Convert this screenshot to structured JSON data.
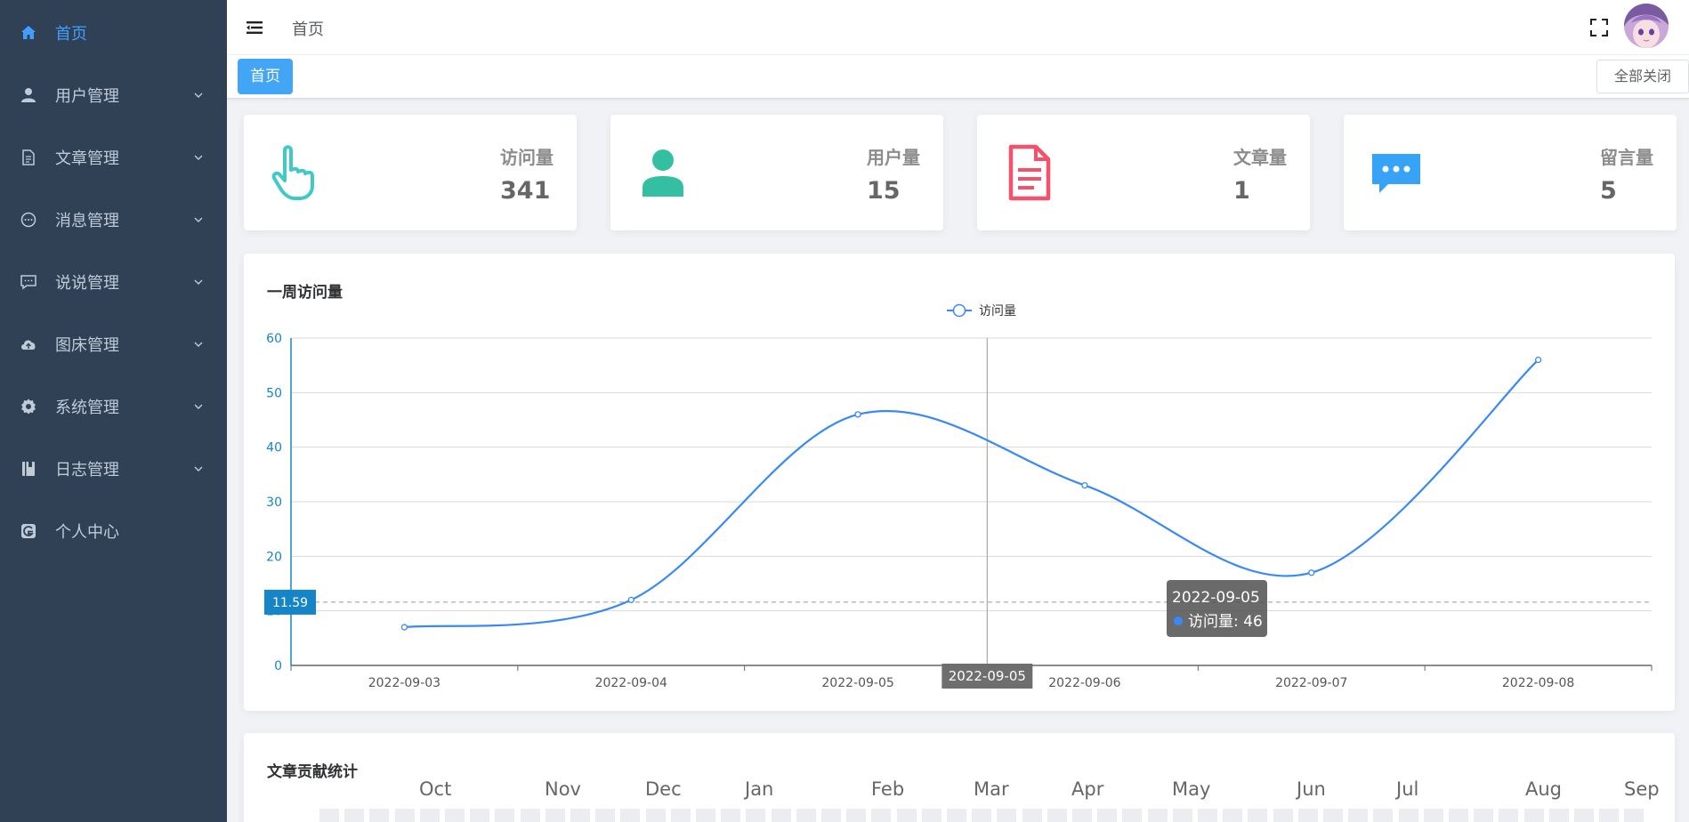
{
  "sidebar": {
    "items": [
      {
        "label": "首页",
        "icon": "home-icon",
        "active": true
      },
      {
        "label": "用户管理",
        "icon": "user-icon"
      },
      {
        "label": "文章管理",
        "icon": "document-icon"
      },
      {
        "label": "消息管理",
        "icon": "chat-icon"
      },
      {
        "label": "说说管理",
        "icon": "comment-icon"
      },
      {
        "label": "图床管理",
        "icon": "cloud-upload-icon"
      },
      {
        "label": "系统管理",
        "icon": "gear-icon"
      },
      {
        "label": "日志管理",
        "icon": "book-icon"
      },
      {
        "label": "个人中心",
        "icon": "profile-icon"
      }
    ]
  },
  "header": {
    "breadcrumb": "首页"
  },
  "tags": {
    "active": "首页",
    "close_all": "全部关闭"
  },
  "stats": [
    {
      "label": "访问量",
      "value": "341",
      "icon": "pointer-hand-icon",
      "color": "#40c9c6"
    },
    {
      "label": "用户量",
      "value": "15",
      "icon": "user-icon",
      "color": "#34bfa3"
    },
    {
      "label": "文章量",
      "value": "1",
      "icon": "document-icon",
      "color": "#f4516c"
    },
    {
      "label": "留言量",
      "value": "5",
      "icon": "message-icon",
      "color": "#36a3f7"
    }
  ],
  "chart_panel": {
    "title": "一周访问量"
  },
  "chart_data": {
    "type": "line",
    "categories": [
      "2022-09-03",
      "2022-09-04",
      "2022-09-05",
      "2022-09-06",
      "2022-09-07",
      "2022-09-08"
    ],
    "series": [
      {
        "name": "访问量",
        "values": [
          7,
          12,
          46,
          33,
          17,
          56
        ],
        "color": "#3888fa"
      }
    ],
    "ylim": [
      0,
      60
    ],
    "yticks": [
      0,
      10,
      20,
      30,
      40,
      50,
      60
    ],
    "average_line": {
      "value": 11.59,
      "label": "11.59"
    },
    "tooltip": {
      "title": "2022-09-05",
      "series": "访问量",
      "value": 46,
      "text": "访问量: 46"
    },
    "axis_pointer_label": "2022-09-05",
    "legend_position": "top-center",
    "grid": true
  },
  "heatmap_panel": {
    "title": "文章贡献统计",
    "months": [
      "Oct",
      "Nov",
      "Dec",
      "Jan",
      "Feb",
      "Mar",
      "Apr",
      "May",
      "Jun",
      "Jul",
      "Aug",
      "Sep"
    ]
  }
}
